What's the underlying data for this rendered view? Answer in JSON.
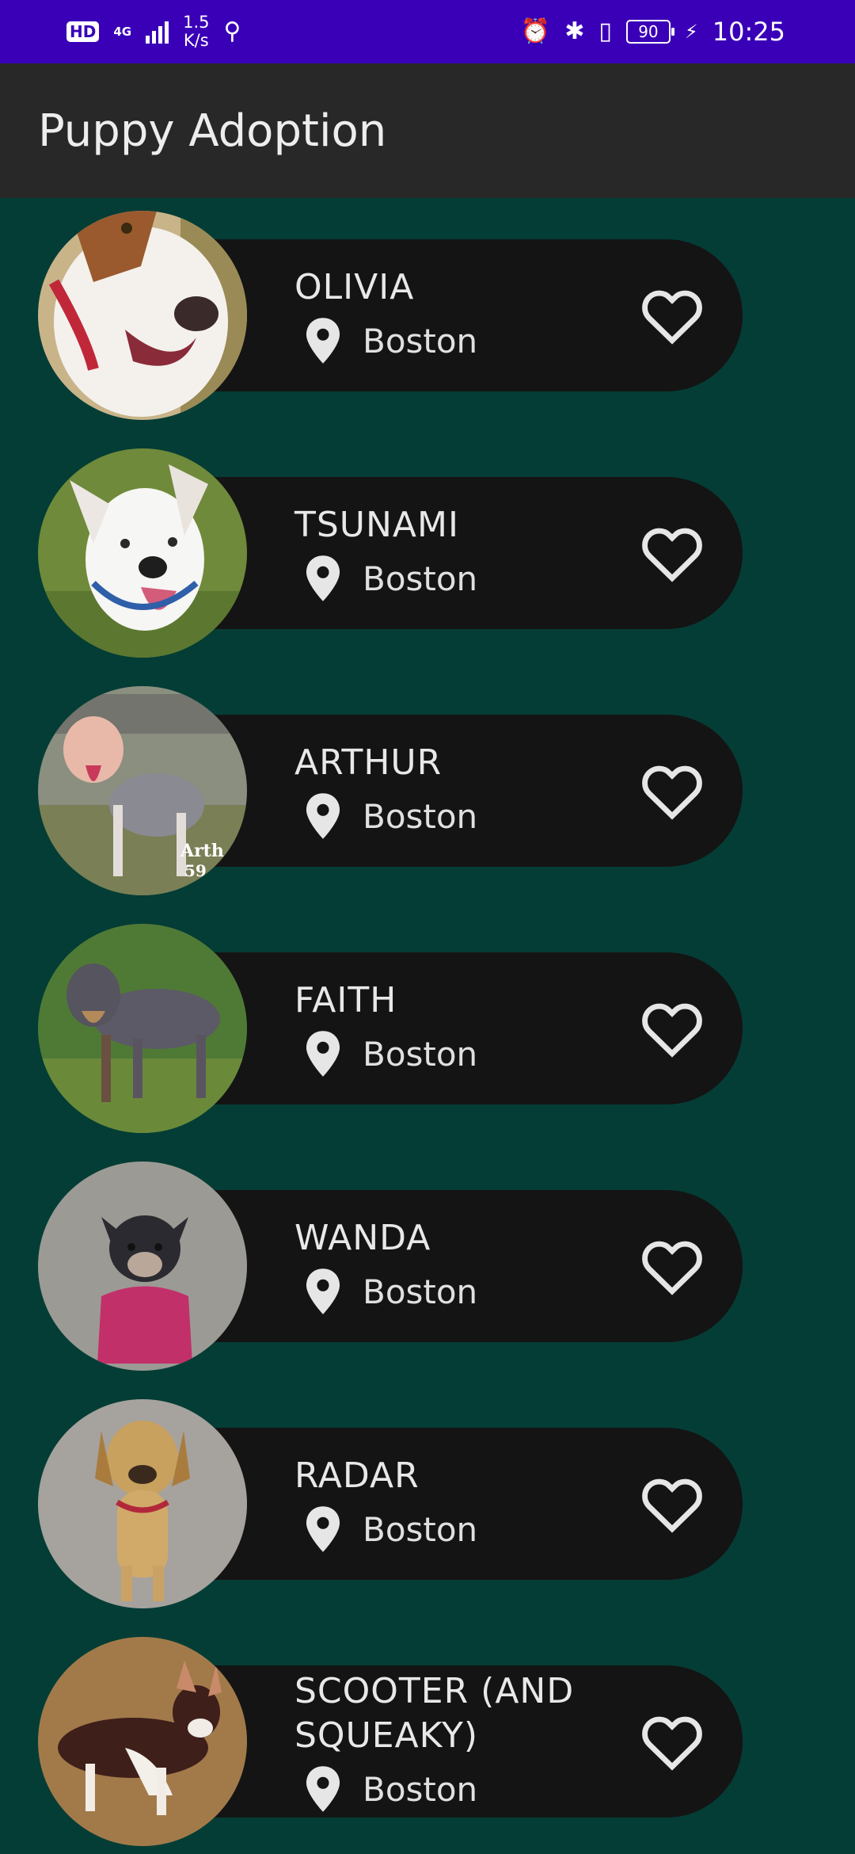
{
  "status_bar": {
    "hd": "HD",
    "network": "4G",
    "speed": "1.5\nK/s",
    "battery": "90",
    "time": "10:25"
  },
  "app": {
    "title": "Puppy Adoption"
  },
  "puppies": [
    {
      "name": "OLIVIA",
      "location": "Boston"
    },
    {
      "name": "TSUNAMI",
      "location": "Boston"
    },
    {
      "name": "ARTHUR",
      "location": "Boston"
    },
    {
      "name": "FAITH",
      "location": "Boston"
    },
    {
      "name": "WANDA",
      "location": "Boston"
    },
    {
      "name": "RADAR",
      "location": "Boston"
    },
    {
      "name": "SCOOTER (AND SQUEAKY)",
      "location": "Boston"
    }
  ],
  "icons": {
    "location": "location-pin-icon",
    "favorite": "heart-outline-icon"
  },
  "colors": {
    "status_bar": "#3a00b8",
    "app_bar": "#282828",
    "background": "#043d35",
    "card": "#141414"
  }
}
